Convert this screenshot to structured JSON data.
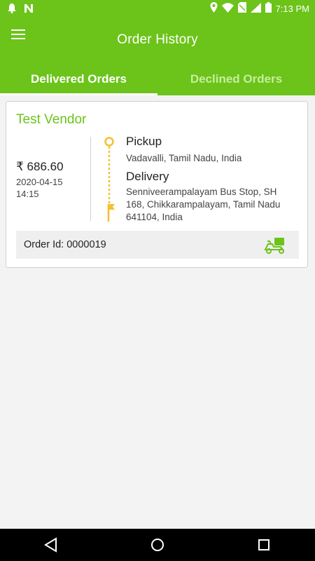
{
  "status_bar": {
    "time": "7:13 PM",
    "icons": [
      "notification-bell-icon",
      "n-notification-icon",
      "location-icon",
      "wifi-icon",
      "no-sim-icon",
      "signal-icon",
      "battery-icon"
    ]
  },
  "app_bar": {
    "title": "Order History",
    "menu_icon": "hamburger-menu-icon"
  },
  "tabs": [
    {
      "label": "Delivered Orders",
      "selected": true
    },
    {
      "label": "Declined Orders",
      "selected": false
    }
  ],
  "order": {
    "vendor": "Test Vendor",
    "amount": "₹ 686.60",
    "date": "2020-04-15",
    "time": "14:15",
    "pickup_label": "Pickup",
    "pickup_address": "Vadavalli, Tamil Nadu, India",
    "delivery_label": "Delivery",
    "delivery_address": "Senniveerampalayam Bus Stop, SH 168, Chikkarampalayam, Tamil Nadu 641104, India",
    "order_id": "Order Id: 0000019",
    "delivery_icon": "delivery-scooter-icon"
  },
  "nav_bar": {
    "icons": [
      "back-triangle-icon",
      "home-circle-icon",
      "recents-square-icon"
    ]
  },
  "colors": {
    "primary": "#6cc31a",
    "route_accent": "#f2c12e",
    "inactive_tab": "#c7ee9e"
  }
}
